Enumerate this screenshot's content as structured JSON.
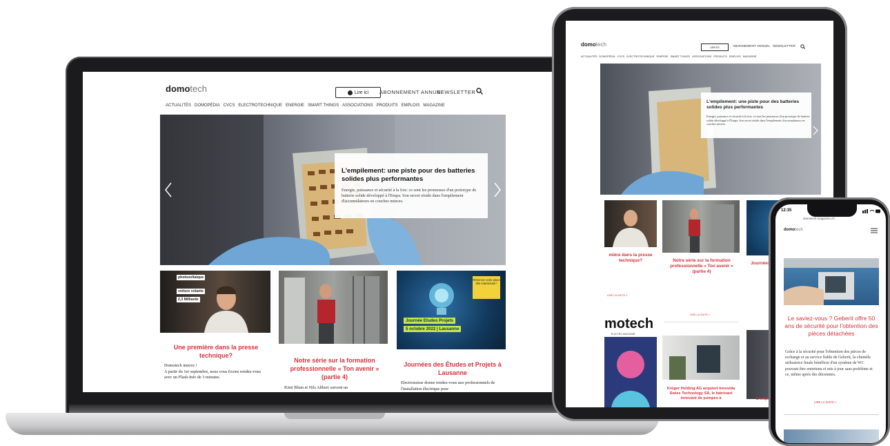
{
  "site": {
    "logo_bold": "domo",
    "logo_light": "tech",
    "lire_ici": "Lire ici",
    "abonnement": "ABONNEMENT ANNUEL",
    "newsletter": "NEWSLETTER",
    "nav": [
      "ACTUALITÉS",
      "DOMOPÉDIA",
      "CVCS",
      "ELECTROTECHNIQUE",
      "ENERGIE",
      "SMART THINGS",
      "ASSOCIATIONS",
      "PRODUITS",
      "EMPLOIS",
      "MAGAZINE"
    ]
  },
  "hero": {
    "title": "L'empilement: une piste pour des batteries solides plus performantes",
    "text": "Energie, puissance et sécurité à la fois: ce sont les promesses d'un prototype de batterie solide développé à l'Empa. Son secret réside dans l'empilement d'accumulateurs en couches minces."
  },
  "cards": [
    {
      "title": "Une première dans la presse technique?",
      "text1": "Domotech innove !",
      "text2": "A partir du 1er septembre, nous vous fixons rendez-vous avec un Flash-Info de 3 minutes.",
      "overlay": [
        "photovoltaïque",
        "voiture volante",
        "2,3 Milliards"
      ]
    },
    {
      "title": "Notre série sur la formation professionnelle « Ton avenir » (partie 4)",
      "text1": "Kimi Blum et Nils Altherr suivent un"
    },
    {
      "title": "Journées des Études et Projets à Lausanne",
      "text1": "Electrosuisse donne rendez-vous aux professionnels de l'installation électrique pour",
      "banner1": "Journée Etudes Projets",
      "banner2": "5 octobre 2022 | Lausanne",
      "note": "Réservez votre place dès maintenant !"
    }
  ],
  "tablet": {
    "card1_title": "mière dans la presse technique?",
    "card2_title": "Notre série sur la formation professionnelle « Ton avenir » (partie 4)",
    "card3_title": "Journées",
    "lire_suite": "LIRE LA SUITE »",
    "mag_logo": "motech",
    "mag_sub": "ELECTRO MAGAZINE",
    "card4_title": "Krüger Holding AG acquiert Innovida Swiss Technology SA, le fabricant innovant de pompes à",
    "card5_title": "L'empla"
  },
  "phone": {
    "time": "12:35",
    "url": "domotech-magazine.ch",
    "title": "Le saviez-vous ? Geberit offre 50 ans de sécurité pour l'obtention des pièces détachées",
    "text": "Grâce à la sécurité pour l'obtention des pièces de rechange et au service fiable de Geberit, la clientèle utilisatrice finale bénéficie d'un système de WC pouvant être entretenu et mis à jour sans problème et ce, même après des décennies.",
    "lire_suite": "LIRE LA SUITE »"
  },
  "colors": {
    "accent": "#d6303a",
    "banner": "#c7e84a"
  }
}
